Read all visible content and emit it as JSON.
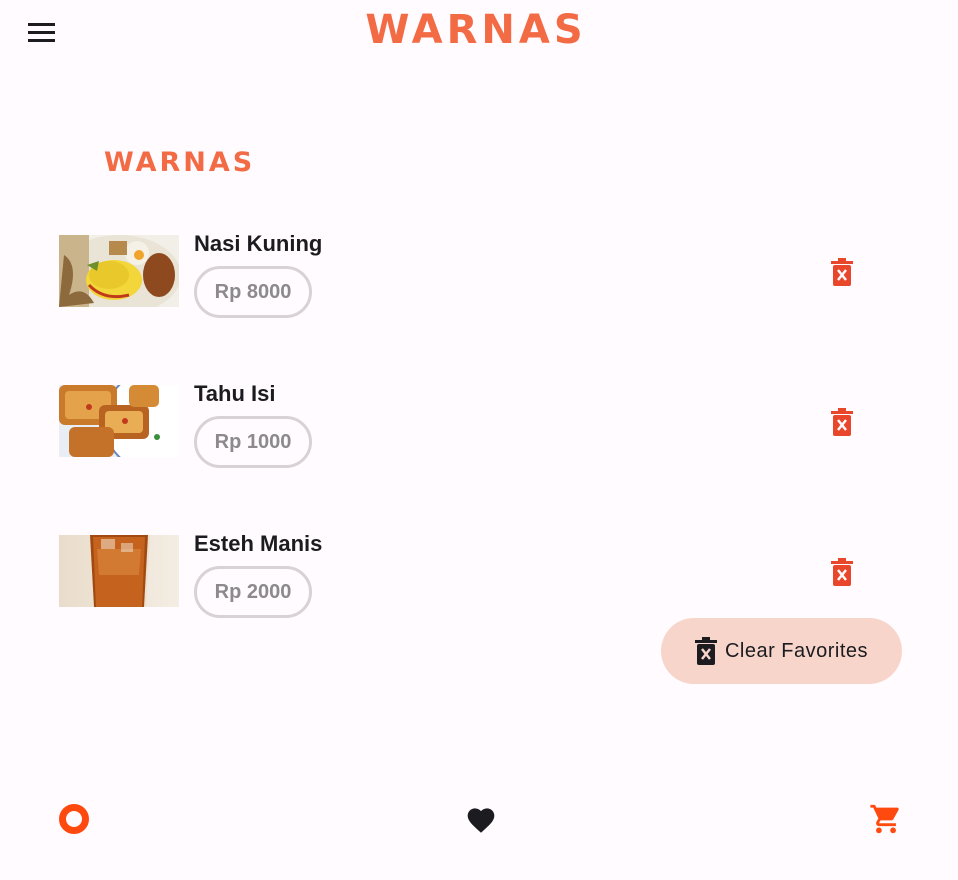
{
  "header": {
    "logo_text": "WARNAS"
  },
  "content": {
    "logo_text": "WARNAS"
  },
  "favorites": [
    {
      "name": "Nasi Kuning",
      "price": "Rp 8000",
      "image": "nasi-kuning-photo"
    },
    {
      "name": "Tahu Isi",
      "price": "Rp 1000",
      "image": "tahu-isi-photo"
    },
    {
      "name": "Esteh Manis",
      "price": "Rp 2000",
      "image": "esteh-manis-photo"
    }
  ],
  "clear_button": {
    "label": "Clear Favorites"
  },
  "icons": {
    "menu": "menu-icon",
    "delete": "delete-forever-icon",
    "home": "home-ring-icon",
    "favorites": "heart-icon",
    "cart": "shopping-cart-icon"
  },
  "colors": {
    "brand": "#F26B45",
    "delete_icon": "#E8472B",
    "clear_button_bg": "#F7D5CB",
    "price_border": "#D8D2D6",
    "price_text": "#8C8A8C",
    "background": "#FFFBFE",
    "nav_active": "#1C1B1F",
    "nav_accent": "#FF4A0F"
  }
}
